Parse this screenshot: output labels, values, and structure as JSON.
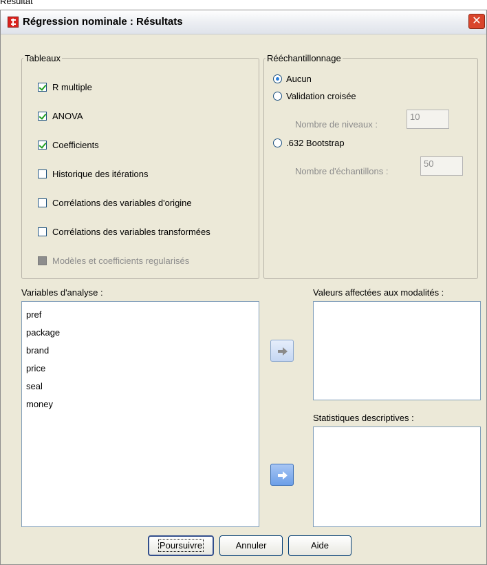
{
  "top_label": "Résultat",
  "window": {
    "title": "Régression nominale : Résultats",
    "close_glyph": "✕"
  },
  "tables_group": {
    "legend": "Tableaux",
    "items": [
      {
        "label": "R multiple",
        "checked": true,
        "enabled": true
      },
      {
        "label": "ANOVA",
        "checked": true,
        "enabled": true
      },
      {
        "label": "Coefficients",
        "checked": true,
        "enabled": true
      },
      {
        "label": "Historique des itérations",
        "checked": false,
        "enabled": true
      },
      {
        "label": "Corrélations des variables d'origine",
        "checked": false,
        "enabled": true
      },
      {
        "label": "Corrélations des variables transformées",
        "checked": false,
        "enabled": true
      },
      {
        "label": "Modèles et coefficients regularisés",
        "checked": false,
        "enabled": false
      }
    ]
  },
  "resampling_group": {
    "legend": "Rééchantillonnage",
    "options": [
      {
        "label": "Aucun",
        "selected": true
      },
      {
        "label": "Validation croisée",
        "selected": false
      },
      {
        "label": ".632 Bootstrap",
        "selected": false
      }
    ],
    "levels_label": "Nombre de niveaux :",
    "levels_value": "10",
    "samples_label": "Nombre d'échantillons :",
    "samples_value": "50"
  },
  "analysis_vars": {
    "label": "Variables d'analyse :",
    "items": [
      "pref",
      "package",
      "brand",
      "price",
      "seal",
      "money"
    ]
  },
  "category_values": {
    "label": "Valeurs affectées aux modalités :"
  },
  "descriptive_stats": {
    "label": "Statistiques descriptives :"
  },
  "buttons": {
    "continue": "Poursuivre",
    "cancel": "Annuler",
    "help": "Aide"
  }
}
